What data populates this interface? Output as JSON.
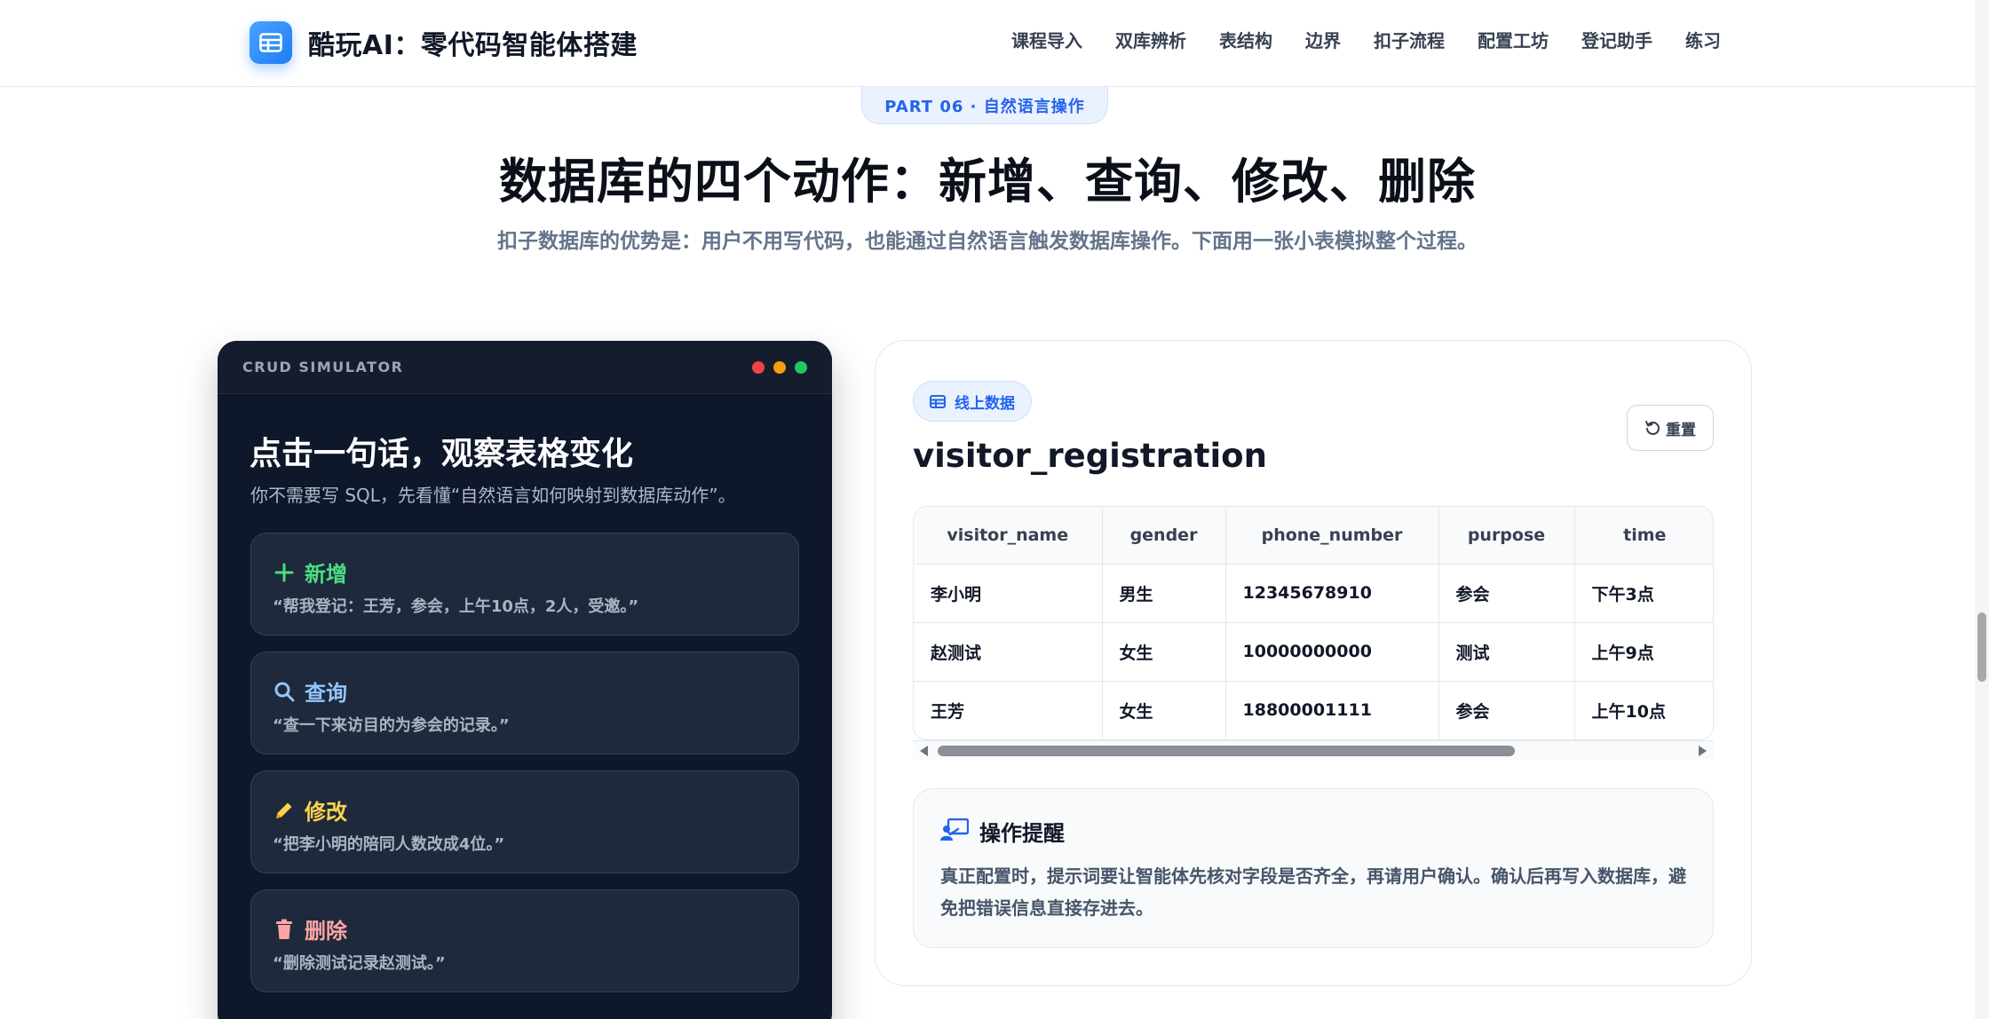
{
  "header": {
    "brand_title": "酷玩AI：零代码智能体搭建",
    "nav": [
      "课程导入",
      "双库辨析",
      "表结构",
      "边界",
      "扣子流程",
      "配置工坊",
      "登记助手",
      "练习"
    ]
  },
  "hero": {
    "part_label": "PART 06 · 自然语言操作",
    "title": "数据库的四个动作：新增、查询、修改、删除",
    "subtitle": "扣子数据库的优势是：用户不用写代码，也能通过自然语言触发数据库操作。下面用一张小表模拟整个过程。"
  },
  "simulator": {
    "header_label": "CRUD SIMULATOR",
    "title": "点击一句话，观察表格变化",
    "subtitle": "你不需要写 SQL，先看懂“自然语言如何映射到数据库动作”。",
    "actions": [
      {
        "label": "新增",
        "icon": "plus-icon",
        "color": "#4ade80",
        "quote": "“帮我登记：王芳，参会，上午10点，2人，受邀。”"
      },
      {
        "label": "查询",
        "icon": "search-icon",
        "color": "#93c5fd",
        "quote": "“查一下来访目的为参会的记录。”"
      },
      {
        "label": "修改",
        "icon": "pencil-icon",
        "color": "#fcd34d",
        "quote": "“把李小明的陪同人数改成4位。”"
      },
      {
        "label": "删除",
        "icon": "trash-icon",
        "color": "#fca5a5",
        "quote": "“删除测试记录赵测试。”"
      }
    ],
    "window_dots": [
      "#ef4444",
      "#f59e0b",
      "#22c55e"
    ]
  },
  "panel": {
    "tag": "线上数据",
    "table_name": "visitor_registration",
    "reset_label": "重置",
    "columns": [
      "visitor_name",
      "gender",
      "phone_number",
      "purpose",
      "time"
    ],
    "rows": [
      [
        "李小明",
        "男生",
        "12345678910",
        "参会",
        "下午3点"
      ],
      [
        "赵测试",
        "女生",
        "10000000000",
        "测试",
        "上午9点"
      ],
      [
        "王芳",
        "女生",
        "18800001111",
        "参会",
        "上午10点"
      ]
    ],
    "tip_title": "操作提醒",
    "tip_body": "真正配置时，提示词要让智能体先核对字段是否齐全，再请用户确认。确认后再写入数据库，避免把错误信息直接存进去。"
  },
  "colors": {
    "accent": "#2563eb",
    "dark_card": "#0f172a"
  }
}
